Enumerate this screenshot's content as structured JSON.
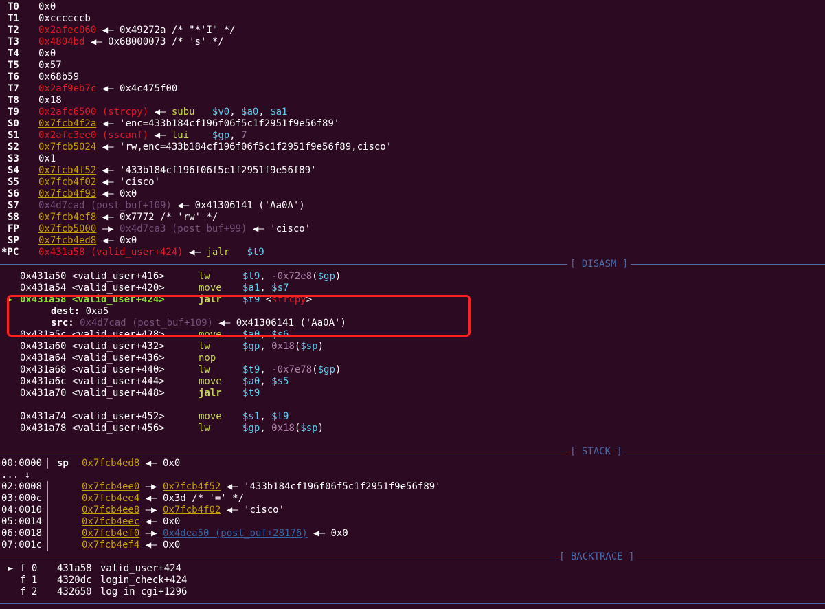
{
  "registers": [
    {
      "name": "T0",
      "parts": [
        {
          "t": "0x0",
          "c": ""
        }
      ]
    },
    {
      "name": "T1",
      "parts": [
        {
          "t": "0xccccccb",
          "c": ""
        }
      ]
    },
    {
      "name": "T2",
      "parts": [
        {
          "t": "0x2afec060",
          "c": "red"
        },
        {
          "t": " ◀— 0x49272a /* \"*'I\" */",
          "c": ""
        }
      ]
    },
    {
      "name": "T3",
      "parts": [
        {
          "t": "0x4804bd",
          "c": "red"
        },
        {
          "t": " ◀— 0x68000073 /* 's' */",
          "c": ""
        }
      ]
    },
    {
      "name": "T4",
      "parts": [
        {
          "t": "0x0",
          "c": ""
        }
      ]
    },
    {
      "name": "T5",
      "parts": [
        {
          "t": "0x57",
          "c": ""
        }
      ]
    },
    {
      "name": "T6",
      "parts": [
        {
          "t": "0x68b59",
          "c": ""
        }
      ]
    },
    {
      "name": "T7",
      "parts": [
        {
          "t": "0x2af9eb7c",
          "c": "red"
        },
        {
          "t": " ◀— 0x4c475f00",
          "c": ""
        }
      ]
    },
    {
      "name": "T8",
      "parts": [
        {
          "t": "0x18",
          "c": ""
        }
      ]
    },
    {
      "name": "T9",
      "parts": [
        {
          "t": "0x2afc6500 (strcpy)",
          "c": "red"
        },
        {
          "t": " ◀— ",
          "c": ""
        },
        {
          "t": "subu",
          "c": "green"
        },
        {
          "t": "   ",
          "c": ""
        },
        {
          "t": "$v0",
          "c": "cyan"
        },
        {
          "t": ", ",
          "c": ""
        },
        {
          "t": "$a0",
          "c": "cyan"
        },
        {
          "t": ", ",
          "c": ""
        },
        {
          "t": "$a1",
          "c": "cyan"
        }
      ]
    },
    {
      "name": "S0",
      "parts": [
        {
          "t": "0x7fcb4f2a",
          "c": "addr-u"
        },
        {
          "t": " ◀— 'enc=433b184cf196f06f5c1f2951f9e56f89'",
          "c": ""
        }
      ]
    },
    {
      "name": "S1",
      "parts": [
        {
          "t": "0x2afc3ee0 (sscanf)",
          "c": "red"
        },
        {
          "t": " ◀— ",
          "c": ""
        },
        {
          "t": "lui",
          "c": "green"
        },
        {
          "t": "    ",
          "c": ""
        },
        {
          "t": "$gp",
          "c": "cyan"
        },
        {
          "t": ", ",
          "c": ""
        },
        {
          "t": "7",
          "c": "violet"
        }
      ]
    },
    {
      "name": "S2",
      "parts": [
        {
          "t": "0x7fcb5024",
          "c": "addr-u"
        },
        {
          "t": " ◀— 'rw,enc=433b184cf196f06f5c1f2951f9e56f89,cisco'",
          "c": ""
        }
      ]
    },
    {
      "name": "S3",
      "parts": [
        {
          "t": "0x1",
          "c": ""
        }
      ]
    },
    {
      "name": "S4",
      "parts": [
        {
          "t": "0x7fcb4f52",
          "c": "addr-u"
        },
        {
          "t": " ◀— '433b184cf196f06f5c1f2951f9e56f89'",
          "c": ""
        }
      ]
    },
    {
      "name": "S5",
      "parts": [
        {
          "t": "0x7fcb4f02",
          "c": "addr-u"
        },
        {
          "t": " ◀— 'cisco'",
          "c": ""
        }
      ]
    },
    {
      "name": "S6",
      "parts": [
        {
          "t": "0x7fcb4f93",
          "c": "addr-u"
        },
        {
          "t": " ◀— 0x0",
          "c": ""
        }
      ]
    },
    {
      "name": "S7",
      "parts": [
        {
          "t": "0x4d7cad (post_buf+109)",
          "c": "purple"
        },
        {
          "t": " ◀— 0x41306141 ('Aa0A')",
          "c": ""
        }
      ]
    },
    {
      "name": "S8",
      "parts": [
        {
          "t": "0x7fcb4ef8",
          "c": "addr-u"
        },
        {
          "t": " ◀— 0x7772 /* 'rw' */",
          "c": ""
        }
      ]
    },
    {
      "name": "FP",
      "parts": [
        {
          "t": "0x7fcb5000",
          "c": "addr-u"
        },
        {
          "t": " —▶ ",
          "c": ""
        },
        {
          "t": "0x4d7ca3 (post_buf+99)",
          "c": "purple"
        },
        {
          "t": " ◀— 'cisco'",
          "c": ""
        }
      ]
    },
    {
      "name": "SP",
      "parts": [
        {
          "t": "0x7fcb4ed8",
          "c": "addr-u"
        },
        {
          "t": " ◀— 0x0",
          "c": ""
        }
      ]
    },
    {
      "name": "*PC",
      "parts": [
        {
          "t": "0x431a58 (valid_user+424)",
          "c": "red"
        },
        {
          "t": " ◀— ",
          "c": ""
        },
        {
          "t": "jalr",
          "c": "green"
        },
        {
          "t": "   ",
          "c": ""
        },
        {
          "t": "$t9",
          "c": "cyan"
        }
      ]
    }
  ],
  "sections": {
    "disasm": "[ DISASM ]",
    "stack": "[ STACK ]",
    "backtrace": "[ BACKTRACE ]"
  },
  "disasm": [
    {
      "addr": "0x431a50 <valid_user+416>",
      "op": "lw",
      "args": [
        {
          "t": "$t9",
          "c": "cyan"
        },
        {
          "t": ", ",
          "c": ""
        },
        {
          "t": "-0x72e8",
          "c": "violet"
        },
        {
          "t": "(",
          "c": ""
        },
        {
          "t": "$gp",
          "c": "cyan"
        },
        {
          "t": ")",
          "c": ""
        }
      ],
      "current": false
    },
    {
      "addr": "0x431a54 <valid_user+420>",
      "op": "move",
      "args": [
        {
          "t": "$a1",
          "c": "cyan"
        },
        {
          "t": ", ",
          "c": ""
        },
        {
          "t": "$s7",
          "c": "cyan"
        }
      ],
      "current": false
    },
    {
      "addr": "0x431a58 <valid_user+424>",
      "op": "jalr",
      "args": [
        {
          "t": "$t9",
          "c": "cyan"
        },
        {
          "t": " <",
          "c": ""
        },
        {
          "t": "strcpy",
          "c": "red"
        },
        {
          "t": ">",
          "c": ""
        }
      ],
      "current": true
    },
    {
      "addr": "0x431a5c <valid_user+428>",
      "op": "move",
      "args": [
        {
          "t": "$a0",
          "c": "cyan"
        },
        {
          "t": ", ",
          "c": ""
        },
        {
          "t": "$s6",
          "c": "cyan"
        }
      ],
      "current": false
    },
    {
      "addr": "0x431a60 <valid_user+432>",
      "op": "lw",
      "args": [
        {
          "t": "$gp",
          "c": "cyan"
        },
        {
          "t": ", ",
          "c": ""
        },
        {
          "t": "0x18",
          "c": "violet"
        },
        {
          "t": "(",
          "c": ""
        },
        {
          "t": "$sp",
          "c": "cyan"
        },
        {
          "t": ")",
          "c": ""
        }
      ],
      "current": false
    },
    {
      "addr": "0x431a64 <valid_user+436>",
      "op": "nop",
      "args": [],
      "current": false
    },
    {
      "addr": "0x431a68 <valid_user+440>",
      "op": "lw",
      "args": [
        {
          "t": "$t9",
          "c": "cyan"
        },
        {
          "t": ", ",
          "c": ""
        },
        {
          "t": "-0x7e78",
          "c": "violet"
        },
        {
          "t": "(",
          "c": ""
        },
        {
          "t": "$gp",
          "c": "cyan"
        },
        {
          "t": ")",
          "c": ""
        }
      ],
      "current": false
    },
    {
      "addr": "0x431a6c <valid_user+444>",
      "op": "move",
      "args": [
        {
          "t": "$a0",
          "c": "cyan"
        },
        {
          "t": ", ",
          "c": ""
        },
        {
          "t": "$s5",
          "c": "cyan"
        }
      ],
      "current": false
    },
    {
      "addr": "0x431a70 <valid_user+448>",
      "op": "jalr",
      "args": [
        {
          "t": "$t9",
          "c": "cyan"
        }
      ],
      "current": false,
      "bold": true
    },
    {
      "addr": "0x431a74 <valid_user+452>",
      "op": "move",
      "args": [
        {
          "t": "$s1",
          "c": "cyan"
        },
        {
          "t": ", ",
          "c": ""
        },
        {
          "t": "$t9",
          "c": "cyan"
        }
      ],
      "current": false
    },
    {
      "addr": "0x431a78 <valid_user+456>",
      "op": "lw",
      "args": [
        {
          "t": "$gp",
          "c": "cyan"
        },
        {
          "t": ", ",
          "c": ""
        },
        {
          "t": "0x18",
          "c": "violet"
        },
        {
          "t": "(",
          "c": ""
        },
        {
          "t": "$sp",
          "c": "cyan"
        },
        {
          "t": ")",
          "c": ""
        }
      ],
      "current": false
    }
  ],
  "call_args": {
    "dest_label": "dest:",
    "dest_value": "0xa5",
    "src_label": "src:",
    "src_addr": "0x4d7cad (post_buf+109)",
    "src_value": " ◀— 0x41306141 ('Aa0A')"
  },
  "current_marker": "►",
  "stack": [
    {
      "idx": "00:0000",
      "reg": "sp",
      "parts": [
        {
          "t": "0x7fcb4ed8",
          "c": "addr-u"
        },
        {
          "t": " ◀— 0x0",
          "c": ""
        }
      ]
    },
    {
      "idx": "... ↓",
      "reg": "",
      "parts": []
    },
    {
      "idx": "02:0008",
      "reg": "",
      "parts": [
        {
          "t": "0x7fcb4ee0",
          "c": "addr-u"
        },
        {
          "t": " —▶ ",
          "c": ""
        },
        {
          "t": "0x7fcb4f52",
          "c": "addr-u"
        },
        {
          "t": " ◀— '433b184cf196f06f5c1f2951f9e56f89'",
          "c": ""
        }
      ]
    },
    {
      "idx": "03:000c",
      "reg": "",
      "parts": [
        {
          "t": "0x7fcb4ee4",
          "c": "addr-u"
        },
        {
          "t": " ◀— 0x3d /* '=' */",
          "c": ""
        }
      ]
    },
    {
      "idx": "04:0010",
      "reg": "",
      "parts": [
        {
          "t": "0x7fcb4ee8",
          "c": "addr-u"
        },
        {
          "t": " —▶ ",
          "c": ""
        },
        {
          "t": "0x7fcb4f02",
          "c": "addr-u"
        },
        {
          "t": " ◀— 'cisco'",
          "c": ""
        }
      ]
    },
    {
      "idx": "05:0014",
      "reg": "",
      "parts": [
        {
          "t": "0x7fcb4eec",
          "c": "addr-u"
        },
        {
          "t": " ◀— 0x0",
          "c": ""
        }
      ]
    },
    {
      "idx": "06:0018",
      "reg": "",
      "parts": [
        {
          "t": "0x7fcb4ef0",
          "c": "addr-u"
        },
        {
          "t": " —▶ ",
          "c": ""
        },
        {
          "t": "0x4dea50 (post_buf+28176)",
          "c": "blue-u"
        },
        {
          "t": " ◀— 0x0",
          "c": ""
        }
      ]
    },
    {
      "idx": "07:001c",
      "reg": "",
      "parts": [
        {
          "t": "0x7fcb4ef4",
          "c": "addr-u"
        },
        {
          "t": " ◀— 0x0",
          "c": ""
        }
      ]
    }
  ],
  "backtrace": [
    {
      "marker": "►",
      "frame": "f 0",
      "addr": "431a58",
      "sym": "valid_user+424"
    },
    {
      "marker": "",
      "frame": "f 1",
      "addr": "4320dc",
      "sym": "login_check+424"
    },
    {
      "marker": "",
      "frame": "f 2",
      "addr": "432650",
      "sym": "log_in_cgi+1296"
    }
  ]
}
